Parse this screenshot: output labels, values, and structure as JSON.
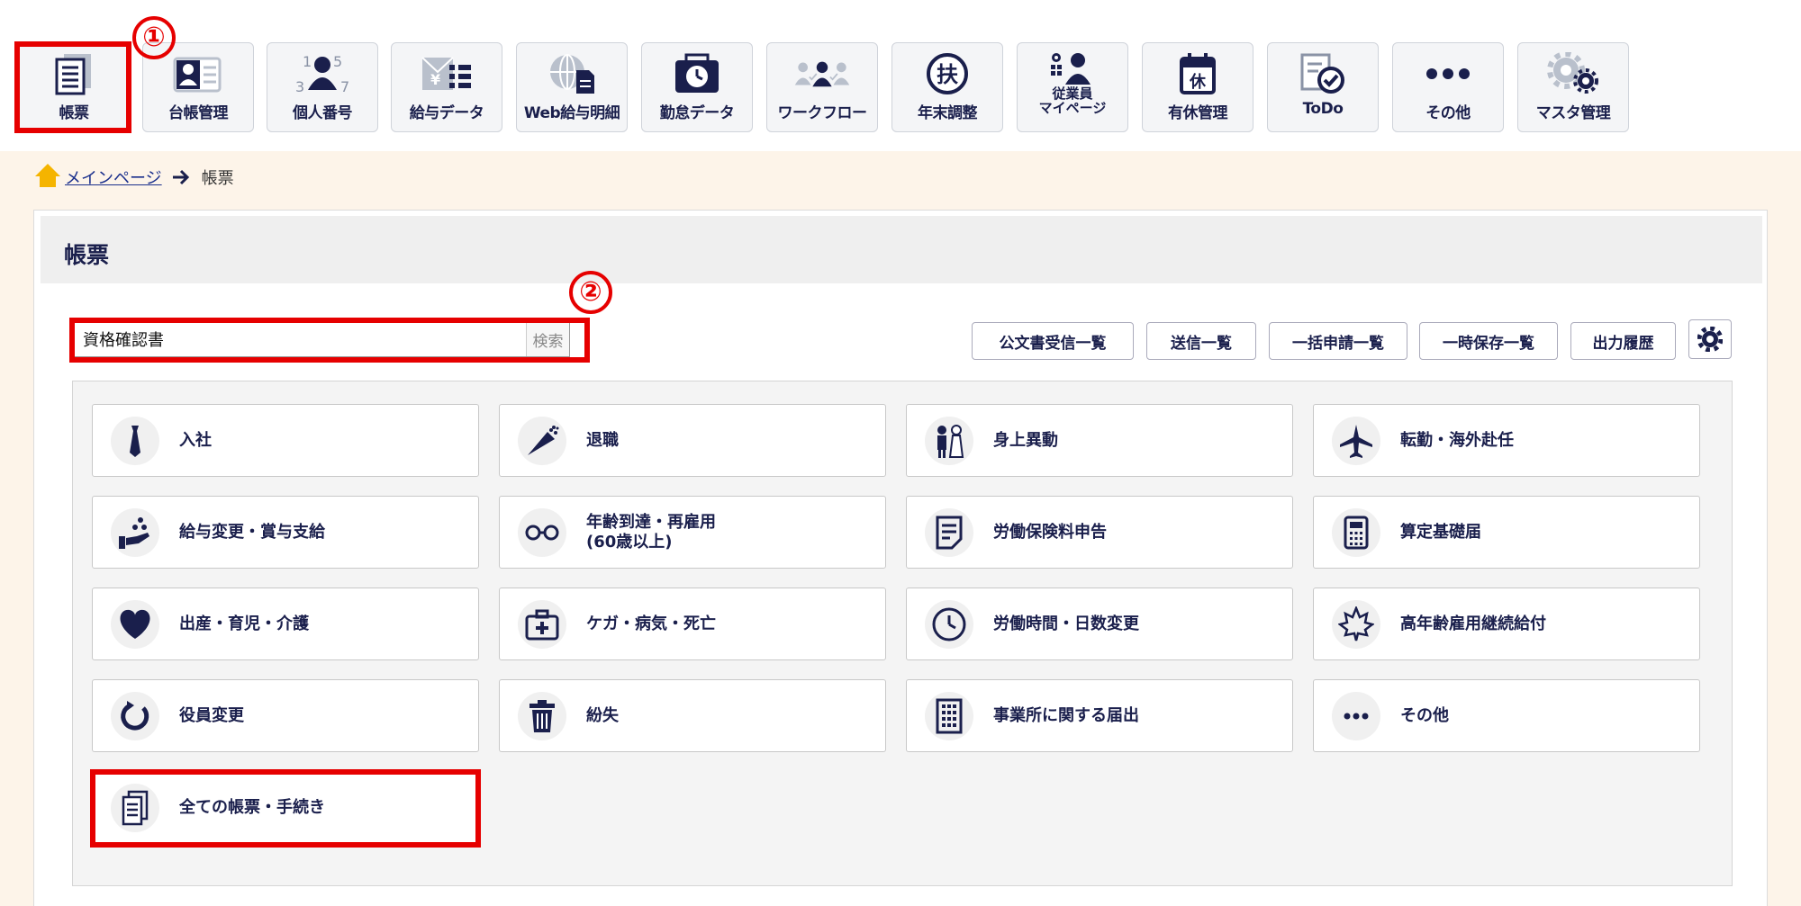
{
  "annotations": {
    "one": "①",
    "two": "②"
  },
  "nav": [
    {
      "label": "帳票",
      "icon": "document-list-icon"
    },
    {
      "label": "台帳管理",
      "icon": "id-card-icon"
    },
    {
      "label": "個人番号",
      "icon": "person-number-icon"
    },
    {
      "label": "給与データ",
      "icon": "salary-envelope-icon"
    },
    {
      "label": "Web給与明細",
      "icon": "globe-document-icon"
    },
    {
      "label": "勤怠データ",
      "icon": "clock-calendar-icon"
    },
    {
      "label": "ワークフロー",
      "icon": "workflow-people-icon"
    },
    {
      "label": "年末調整",
      "icon": "fu-kanji-icon"
    },
    {
      "label": "従業員\nマイページ",
      "label_line1": "従業員",
      "label_line2": "マイページ",
      "icon": "employee-mypage-icon"
    },
    {
      "label": "有休管理",
      "icon": "calendar-kyu-icon"
    },
    {
      "label": "ToDo",
      "icon": "todo-check-icon"
    },
    {
      "label": "その他",
      "icon": "more-dots-icon"
    },
    {
      "label": "マスタ管理",
      "icon": "gears-icon"
    }
  ],
  "breadcrumb": {
    "home": "メインページ",
    "current": "帳票"
  },
  "panel": {
    "title": "帳票"
  },
  "search": {
    "value": "資格確認書",
    "button": "検索"
  },
  "actions": [
    "公文書受信一覧",
    "送信一覧",
    "一括申請一覧",
    "一時保存一覧",
    "出力履歴"
  ],
  "categories": [
    {
      "label": "入社",
      "icon": "necktie-icon"
    },
    {
      "label": "退職",
      "icon": "bouquet-icon"
    },
    {
      "label": "身上異動",
      "icon": "couple-icon"
    },
    {
      "label": "転勤・海外赴任",
      "icon": "airplane-icon"
    },
    {
      "label": "給与変更・賞与支給",
      "icon": "hand-coins-icon"
    },
    {
      "label": "年齢到達・再雇用",
      "label2": "(60歳以上)",
      "icon": "glasses-icon"
    },
    {
      "label": "労働保険料申告",
      "icon": "form-icon"
    },
    {
      "label": "算定基礎届",
      "icon": "calculator-icon"
    },
    {
      "label": "出産・育児・介護",
      "icon": "heart-icon"
    },
    {
      "label": "ケガ・病気・死亡",
      "icon": "first-aid-icon"
    },
    {
      "label": "労働時間・日数変更",
      "icon": "clock-icon"
    },
    {
      "label": "高年齢雇用継続給付",
      "icon": "maple-leaf-icon"
    },
    {
      "label": "役員変更",
      "icon": "refresh-icon"
    },
    {
      "label": "紛失",
      "icon": "trash-icon"
    },
    {
      "label": "事業所に関する届出",
      "icon": "building-icon"
    },
    {
      "label": "その他",
      "icon": "ellipsis-icon"
    },
    {
      "label": "全ての帳票・手続き",
      "icon": "documents-icon"
    }
  ]
}
